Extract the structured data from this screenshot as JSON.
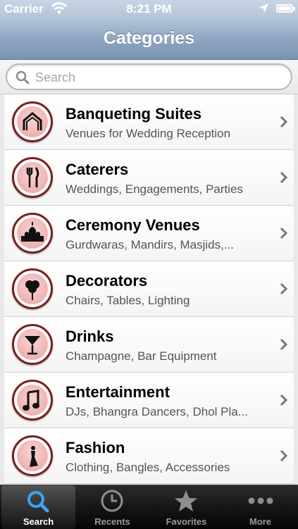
{
  "status_bar": {
    "carrier": "Carrier",
    "time": "8:21 PM"
  },
  "nav": {
    "title": "Categories"
  },
  "search": {
    "placeholder": "Search"
  },
  "categories": [
    {
      "title": "Banqueting Suites",
      "subtitle": "Venues for Wedding Reception",
      "icon": "banquet-arch-icon"
    },
    {
      "title": "Caterers",
      "subtitle": "Weddings, Engagements, Parties",
      "icon": "fork-knife-icon"
    },
    {
      "title": "Ceremony Venues",
      "subtitle": "Gurdwaras, Mandirs, Masjids,...",
      "icon": "temple-icon"
    },
    {
      "title": "Decorators",
      "subtitle": "Chairs, Tables, Lighting",
      "icon": "balloons-icon"
    },
    {
      "title": "Drinks",
      "subtitle": "Champagne, Bar Equipment",
      "icon": "cocktail-glass-icon"
    },
    {
      "title": "Entertainment",
      "subtitle": "DJs, Bhangra Dancers, Dhol Pla...",
      "icon": "music-note-icon"
    },
    {
      "title": "Fashion",
      "subtitle": "Clothing, Bangles, Accessories",
      "icon": "dress-icon"
    }
  ],
  "tabs": [
    {
      "label": "Search",
      "icon": "search-icon",
      "selected": true
    },
    {
      "label": "Recents",
      "icon": "clock-icon",
      "selected": false
    },
    {
      "label": "Favorites",
      "icon": "star-icon",
      "selected": false
    },
    {
      "label": "More",
      "icon": "more-dots-icon",
      "selected": false
    }
  ],
  "colors": {
    "navbar": "#8fa6c2",
    "badge_ring": "#7a1f1f",
    "badge_fill": "#efb1b1",
    "tab_selected": "#3ba3f0"
  }
}
